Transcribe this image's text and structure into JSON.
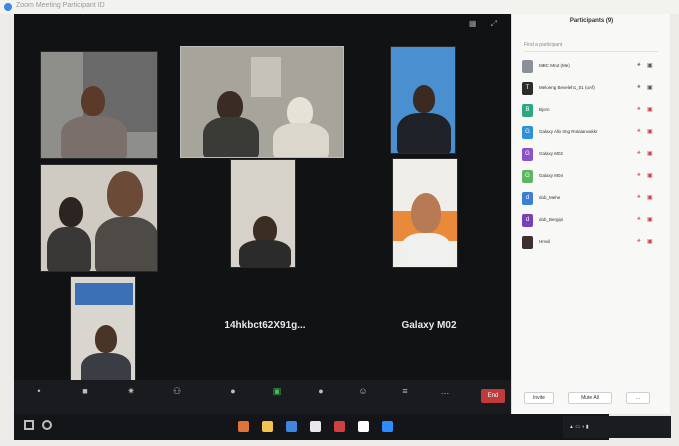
{
  "window": {
    "title": "Zoom Meeting Participant ID"
  },
  "tiles": [
    {
      "id": "t1",
      "bg": "#8e8f8b",
      "shirt": "#7a6f6a"
    },
    {
      "id": "t2",
      "bg": "#a7a49c",
      "shirt": "#3a3a36"
    },
    {
      "id": "t3",
      "bg": "#4a8fd0",
      "shirt": "#1f2228"
    },
    {
      "id": "t4",
      "bg": "#cfcbc2",
      "shirt": "#4e4b46"
    },
    {
      "id": "t5",
      "bg": "#d6d2ca",
      "shirt": "#2b2b2b"
    },
    {
      "id": "t6",
      "bg": "#efeee8",
      "shirt": "#f0f0ee"
    },
    {
      "id": "t7",
      "bg": "#d9d6cf",
      "shirt": "#3b3d45"
    }
  ],
  "name_tiles": [
    {
      "label": "14hkbct62X91g..."
    },
    {
      "label": "Galaxy M02"
    }
  ],
  "controls": [
    {
      "icon": "microphone-icon",
      "glyph": "•"
    },
    {
      "icon": "video-icon",
      "glyph": "■"
    },
    {
      "icon": "security-icon",
      "glyph": "✷"
    },
    {
      "icon": "participants-icon",
      "glyph": "⚇"
    },
    {
      "icon": "chat-icon",
      "glyph": "●"
    },
    {
      "icon": "share-screen-icon",
      "glyph": "▣"
    },
    {
      "icon": "record-icon",
      "glyph": "●"
    },
    {
      "icon": "reactions-icon",
      "glyph": "☺"
    },
    {
      "icon": "apps-icon",
      "glyph": "≡"
    },
    {
      "icon": "more-icon",
      "glyph": "…"
    }
  ],
  "end_button": {
    "label": "End"
  },
  "panel": {
    "title": "Participants (9)",
    "search_placeholder": "Find a participant",
    "participants": [
      {
        "name": "MBC Mrut (Me)",
        "avatar_color": "#8a8f99",
        "avatar_text": "",
        "mic_color": "#555555",
        "cam_color": "#555555"
      },
      {
        "name": "Meloeng Beveleh1_01 (uAf)",
        "avatar_color": "#2c2c2c",
        "avatar_text": "T",
        "mic_color": "#555555",
        "cam_color": "#555555"
      },
      {
        "name": "Bjorn",
        "avatar_color": "#2aa883",
        "avatar_text": "B",
        "mic_color": "#d04040",
        "cam_color": "#d04040"
      },
      {
        "name": "Galaxy Allx tmg Rotaianvakkr",
        "avatar_color": "#2f8fd8",
        "avatar_text": "G",
        "mic_color": "#d04040",
        "cam_color": "#d04040"
      },
      {
        "name": "Galaxy M02",
        "avatar_color": "#8a52c8",
        "avatar_text": "G",
        "mic_color": "#d04040",
        "cam_color": "#d04040"
      },
      {
        "name": "Galaxy M04",
        "avatar_color": "#5cb860",
        "avatar_text": "G",
        "mic_color": "#d04040",
        "cam_color": "#d04040"
      },
      {
        "name": "dob_Mehe",
        "avatar_color": "#3b7fd6",
        "avatar_text": "d",
        "mic_color": "#d04040",
        "cam_color": "#d04040"
      },
      {
        "name": "dob_Bergipi",
        "avatar_color": "#7d3fb8",
        "avatar_text": "d",
        "mic_color": "#d04040",
        "cam_color": "#d04040"
      },
      {
        "name": "Hmvil",
        "avatar_color": "#3a3030",
        "avatar_text": "",
        "mic_color": "#d04040",
        "cam_color": "#d04040"
      }
    ],
    "invite_label": "Invite",
    "mute_all_label": "Mute All",
    "more_label": "..."
  },
  "taskbar_icons": [
    {
      "icon": "edge-icon",
      "color": "#e0733a"
    },
    {
      "icon": "file-explorer-icon",
      "color": "#f2c44d"
    },
    {
      "icon": "chrome-icon",
      "color": "#3f86e0"
    },
    {
      "icon": "store-icon",
      "color": "#e8e8e8"
    },
    {
      "icon": "mail-icon",
      "color": "#d04040"
    },
    {
      "icon": "photos-icon",
      "color": "#ffffff"
    },
    {
      "icon": "zoom-icon",
      "color": "#2d8cff"
    }
  ]
}
